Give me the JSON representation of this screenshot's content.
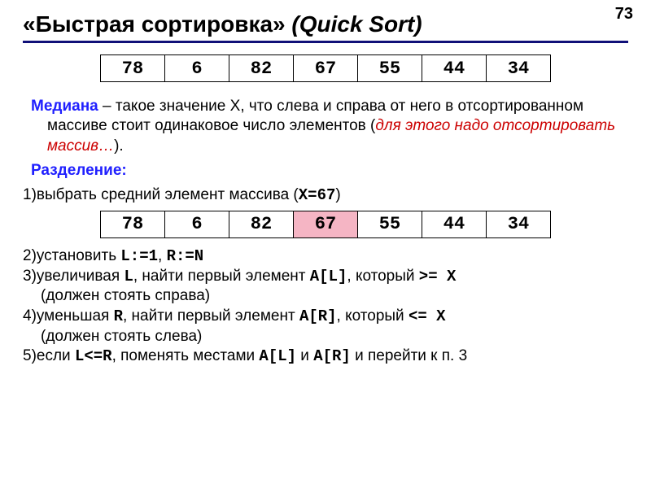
{
  "page_number": "73",
  "title_main": "«Быстрая сортировка»",
  "title_sub": "(Quick Sort)",
  "array1": [
    "78",
    "6",
    "82",
    "67",
    "55",
    "44",
    "34"
  ],
  "median_lead": "Медиана",
  "median_rest": " – такое значение X, что слева и справа от него в отсортированном массиве стоит одинаковое число элементов (",
  "median_italic": "для этого надо отсортировать массив…",
  "median_close": ").",
  "split_label": "Разделение:",
  "step1_pre": "1)выбрать средний элемент массива (",
  "step1_mono": "X=67",
  "step1_post": ")",
  "array2": [
    "78",
    "6",
    "82",
    "67",
    "55",
    "44",
    "34"
  ],
  "array2_highlight_index": 3,
  "step2_a": "2)установить ",
  "step2_m1": "L:=1",
  "step2_b": ", ",
  "step2_m2": "R:=N",
  "step3_a": "3)увеличивая ",
  "step3_m1": "L",
  "step3_b": ", найти первый элемент ",
  "step3_m2": "A[L]",
  "step3_c": ", который ",
  "step3_m3": ">= X",
  "step3_d": " (должен стоять справа)",
  "step4_a": "4)уменьшая ",
  "step4_m1": "R",
  "step4_b": ", найти первый элемент ",
  "step4_m2": "A[R]",
  "step4_c": ", который ",
  "step4_m3": "<= X",
  "step4_d": " (должен стоять слева)",
  "step5_a": "5)если ",
  "step5_m1": "L<=R",
  "step5_b": ", поменять местами ",
  "step5_m2": "A[L]",
  "step5_c": " и ",
  "step5_m3": "A[R]",
  "step5_d": " и перейти к п. 3",
  "chart_data": {
    "type": "table",
    "tables": [
      {
        "name": "array1",
        "values": [
          78,
          6,
          82,
          67,
          55,
          44,
          34
        ]
      },
      {
        "name": "array2",
        "values": [
          78,
          6,
          82,
          67,
          55,
          44,
          34
        ],
        "highlighted_index": 3,
        "highlighted_value": 67
      }
    ],
    "pivot": 67,
    "title": "«Быстрая сортировка» (Quick Sort)"
  }
}
